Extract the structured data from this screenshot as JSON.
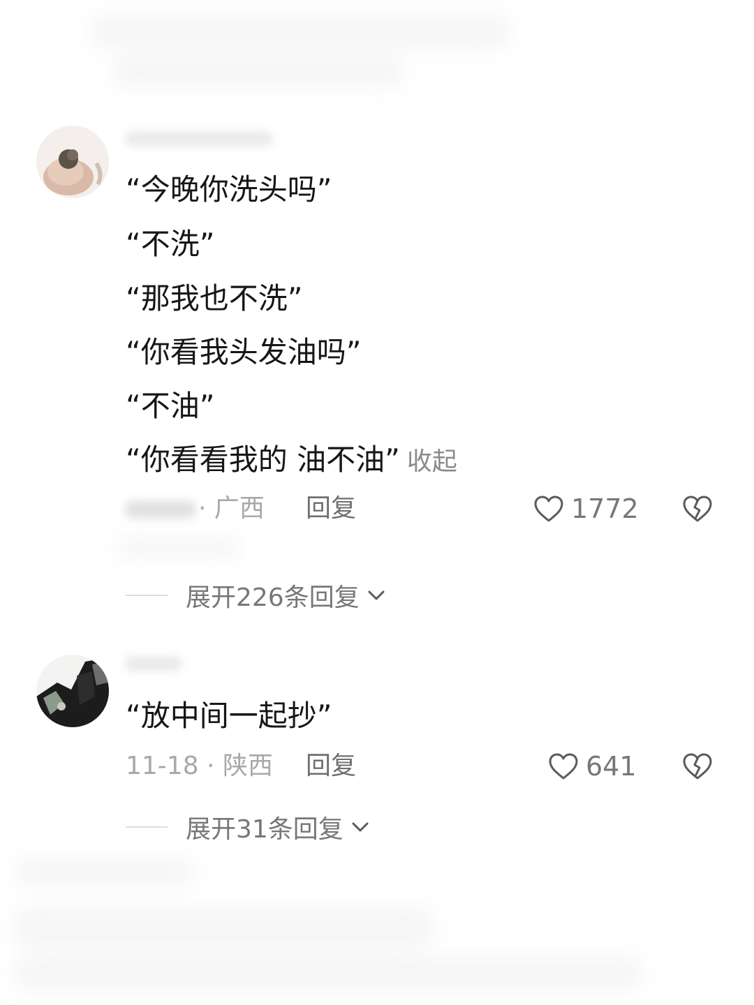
{
  "comments": [
    {
      "lines": [
        "“今晚你洗头吗”",
        "“不洗”",
        "“那我也不洗”",
        "“你看我头发油吗”",
        "“不油”",
        "“你看看我的 油不油”"
      ],
      "collapse_label": "收起",
      "meta": "· 广西",
      "reply_label": "回复",
      "likes": "1772",
      "expand_label": "展开226条回复"
    },
    {
      "lines": [
        "“放中间一起抄”"
      ],
      "meta": "11-18 · 陕西",
      "reply_label": "回复",
      "likes": "641",
      "expand_label": "展开31条回复"
    }
  ],
  "icons": {
    "like": "heart-outline-icon",
    "dislike": "broken-heart-icon",
    "expand": "chevron-down-icon"
  },
  "colors": {
    "text": "#161616",
    "meta": "#a8a8a8",
    "secondary": "#777777"
  }
}
